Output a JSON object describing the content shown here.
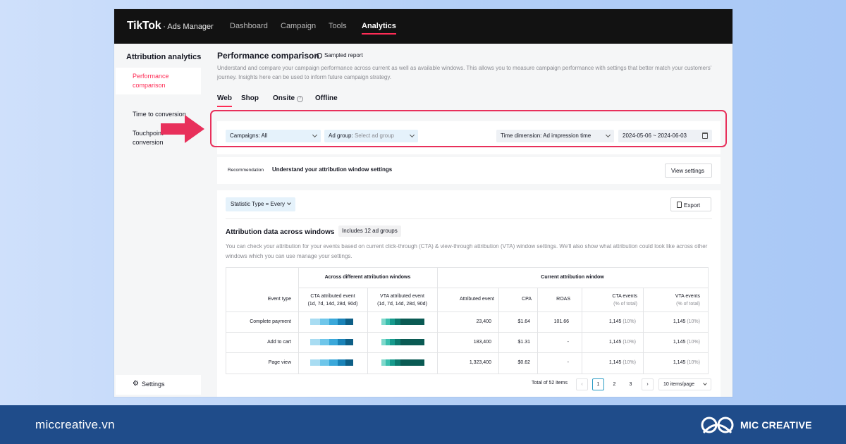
{
  "header": {
    "brand": "TikTok",
    "brand_suffix": "· Ads Manager",
    "nav": [
      "Dashboard",
      "Campaign",
      "Tools",
      "Analytics"
    ],
    "active_nav": "Analytics"
  },
  "sidebar": {
    "title": "Attribution analytics",
    "items": [
      "Performance comparison",
      "Time to conversion",
      "Touchpoint conversion"
    ],
    "active_item": "Performance comparison",
    "settings_label": "Settings"
  },
  "page": {
    "title": "Performance comparison",
    "sampled_label": "Sampled report",
    "description": "Understand and compare your campaign performance across current as well as available windows. This allows you to measure campaign performance with settings that better match your customers' journey. Insights here can be used to inform future campaign strategy."
  },
  "tabs": [
    "Web",
    "Shop",
    "Onsite",
    "Offline"
  ],
  "active_tab": "Web",
  "filters": {
    "campaigns_label": "Campaigns:",
    "campaigns_value": "All",
    "adgroup_label": "Ad group:",
    "adgroup_placeholder": "Select ad group",
    "time_dimension_label": "Time dimension:",
    "time_dimension_value": "Ad impression time",
    "date_range": "2024-05-06 ~ 2024-06-03"
  },
  "recommendation": {
    "tag": "Recommendation",
    "text": "Understand your attribution window settings",
    "button": "View settings"
  },
  "report": {
    "statistic_type": "Statistic Type = Every",
    "export_label": "Export",
    "section_title": "Attribution data across windows",
    "badge": "Includes 12 ad groups",
    "description": "You can check your attribution for your events based on current click-through (CTA) & view-through attribution (VTA) window settings. We'll also show what attribution could look like across other windows which you can use manage your settings."
  },
  "table": {
    "group_headers": [
      "Across different attribution windows",
      "Current attribution window"
    ],
    "columns": {
      "event_type": "Event type",
      "cta_window": "CTA attributed event",
      "cta_window_sub": "(1d, 7d, 14d, 28d, 90d)",
      "vta_window": "VTA attributed event",
      "vta_window_sub": "(1d, 7d, 14d, 28d, 90d)",
      "attributed_event": "Attributed event",
      "cpa": "CPA",
      "roas": "ROAS",
      "cta_events": "CTA events",
      "cta_events_sub": "(% of total)",
      "vta_events": "VTA events",
      "vta_events_sub": "(% of total)"
    },
    "rows": [
      {
        "event": "Complete payment",
        "attributed": "23,400",
        "cpa": "$1.64",
        "roas": "101.66",
        "cta": "1,145",
        "cta_pct": "(10%)",
        "vta": "1,145",
        "vta_pct": "(10%)"
      },
      {
        "event": "Add to cart",
        "attributed": "183,400",
        "cpa": "$1.31",
        "roas": "-",
        "cta": "1,145",
        "cta_pct": "(10%)",
        "vta": "1,145",
        "vta_pct": "(10%)"
      },
      {
        "event": "Page view",
        "attributed": "1,323,400",
        "cpa": "$0.62",
        "roas": "-",
        "cta": "1,145",
        "cta_pct": "(10%)",
        "vta": "1,145",
        "vta_pct": "(10%)"
      }
    ]
  },
  "pagination": {
    "total": "Total of 52 items",
    "prev": "‹",
    "pages": [
      "1",
      "2",
      "3"
    ],
    "current": "1",
    "next": "›",
    "page_size": "10 items/page"
  },
  "footer": {
    "url": "miccreative.vn",
    "brand": "MIC CREATIVE"
  },
  "colors": {
    "accent": "#fe2c55",
    "highlight": "#e8305b",
    "footer_bg": "#1f4c8a",
    "cta_bar": [
      "#a8dcf2",
      "#6ec6ea",
      "#3aa8da",
      "#1a83b8",
      "#0e5f86"
    ],
    "vta_bar": [
      "#7fd9cc",
      "#3cbfae",
      "#169a8c",
      "#0c7a6e",
      "#0a5a53"
    ]
  }
}
